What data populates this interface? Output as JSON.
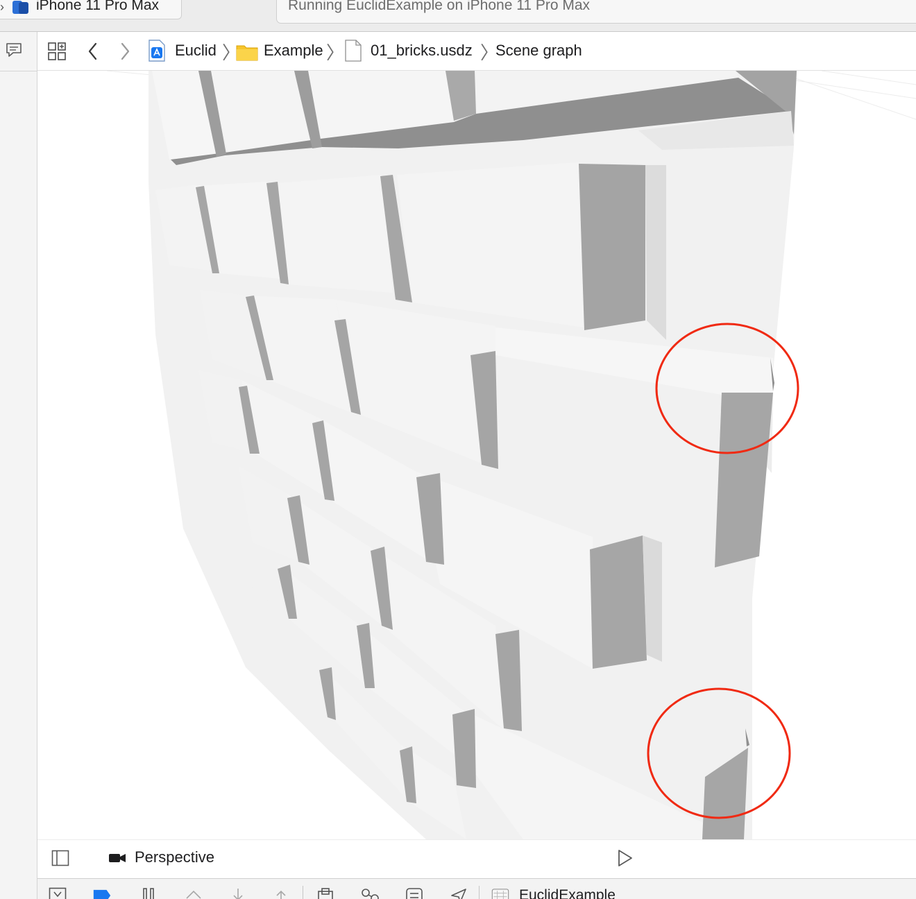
{
  "toolbar": {
    "scheme_device": "iPhone 11 Pro Max",
    "activity_status": "Running EuclidExample on iPhone 11 Pro Max"
  },
  "jumpbar": {
    "crumbs": [
      "Euclid",
      "Example",
      "01_bricks.usdz",
      "Scene graph"
    ]
  },
  "viewport": {
    "camera_label": "Perspective",
    "annotation_color": "#f02a13"
  },
  "debug": {
    "process_name": "EuclidExample"
  },
  "colors": {
    "accent": "#1a78f0",
    "folder": "#f7c52b"
  }
}
